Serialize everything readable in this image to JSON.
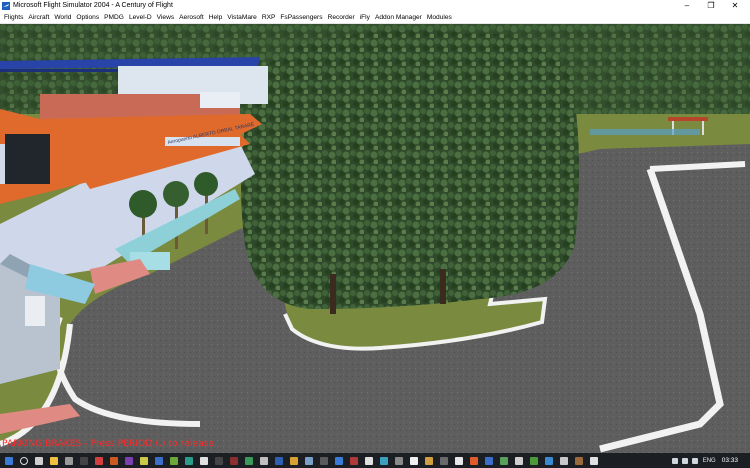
{
  "window": {
    "title": "Microsoft Flight Simulator 2004 - A Century of Flight",
    "controls": [
      "minimize-icon",
      "maximize-icon",
      "close-icon"
    ]
  },
  "menu": {
    "items": [
      "Flights",
      "Aircraft",
      "World",
      "Options",
      "PMDG",
      "Level-D",
      "Views",
      "Aerosoft",
      "Help",
      "VistaMare",
      "RXP",
      "FsPassengers",
      "Recorder",
      "iFly",
      "Addon Manager",
      "Modules"
    ]
  },
  "scene": {
    "terminal_sign": "Aeropuerto ALBERTO ORBAL TARARÉ"
  },
  "status": {
    "parking_brake": "PARKING BRAKES - Press PERIOD (.) to release."
  },
  "taskbar": {
    "language": "ENG",
    "time": "03:33",
    "icons": [
      "windows-start-icon",
      "search-icon",
      "task-view-icon",
      "file-explorer-icon",
      "app-icon",
      "app-icon",
      "app-icon",
      "app-icon",
      "app-icon",
      "app-icon",
      "app-icon",
      "app-icon",
      "app-icon",
      "app-icon",
      "app-icon",
      "app-icon",
      "app-icon",
      "app-icon",
      "app-icon",
      "app-icon",
      "app-icon",
      "app-icon",
      "app-icon",
      "app-icon",
      "app-icon",
      "app-icon",
      "app-icon",
      "app-icon",
      "app-icon",
      "app-icon",
      "app-icon",
      "app-icon",
      "app-icon",
      "app-icon",
      "app-icon",
      "app-icon",
      "app-icon",
      "app-icon",
      "app-icon",
      "app-icon",
      "app-icon",
      "app-icon",
      "app-icon",
      "app-icon",
      "app-icon"
    ],
    "colors": {
      "background": "#1b1f24",
      "accent": "#3a7bd5"
    }
  }
}
